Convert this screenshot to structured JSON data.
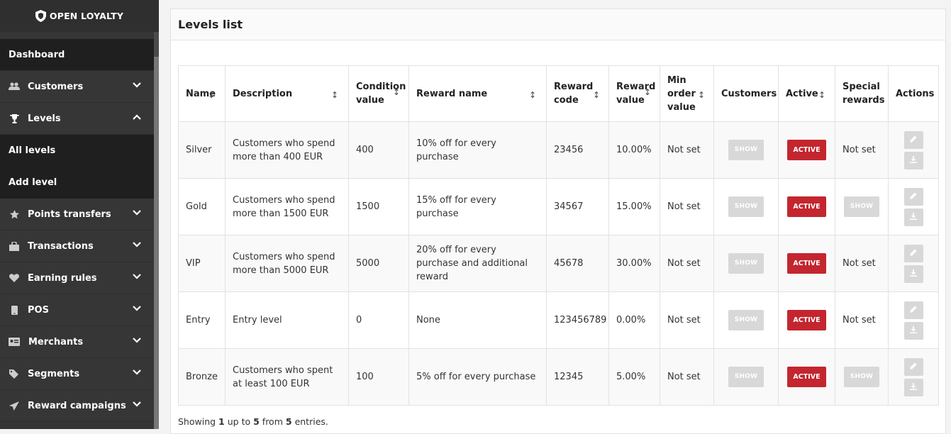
{
  "brand": {
    "name": "OPEN LOYALTY"
  },
  "sidebar": {
    "items": [
      {
        "label": "Dashboard",
        "icon": ""
      },
      {
        "label": "Customers",
        "icon": "users-icon"
      },
      {
        "label": "Levels",
        "icon": "trophy-icon"
      },
      {
        "label": "All levels"
      },
      {
        "label": "Add level"
      },
      {
        "label": "Points transfers",
        "icon": "star-icon"
      },
      {
        "label": "Transactions",
        "icon": "shopping-bag-icon"
      },
      {
        "label": "Earning rules",
        "icon": "heart-icon"
      },
      {
        "label": "POS",
        "icon": "mobile-icon"
      },
      {
        "label": "Merchants",
        "icon": "id-card-icon"
      },
      {
        "label": "Segments",
        "icon": "tags-icon"
      },
      {
        "label": "Reward campaigns",
        "icon": "paper-plane-icon"
      }
    ]
  },
  "page": {
    "title": "Levels list"
  },
  "table": {
    "headers": [
      "Name",
      "Description",
      "Condition value",
      "Reward name",
      "Reward code",
      "Reward value",
      "Min order value",
      "Customers",
      "Active",
      "Special rewards",
      "Actions"
    ],
    "show_label": "SHOW",
    "active_label": "ACTIVE",
    "rows": [
      {
        "name": "Silver",
        "description": "Customers who spend more than 400 EUR",
        "condition": "400",
        "reward_name": "10% off for every purchase",
        "reward_code": "23456",
        "reward_value": "10.00%",
        "min_order": "Not set",
        "special": "Not set"
      },
      {
        "name": "Gold",
        "description": "Customers who spend more than 1500 EUR",
        "condition": "1500",
        "reward_name": "15% off for every purchase",
        "reward_code": "34567",
        "reward_value": "15.00%",
        "min_order": "Not set",
        "special": "SHOW"
      },
      {
        "name": "VIP",
        "description": "Customers who spend more than 5000 EUR",
        "condition": "5000",
        "reward_name": "20% off for every purchase and additional reward",
        "reward_code": "45678",
        "reward_value": "30.00%",
        "min_order": "Not set",
        "special": "Not set"
      },
      {
        "name": "Entry",
        "description": "Entry level",
        "condition": "0",
        "reward_name": "None",
        "reward_code": "123456789",
        "reward_value": "0.00%",
        "min_order": "Not set",
        "special": "Not set"
      },
      {
        "name": "Bronze",
        "description": "Customers who spent at least 100 EUR",
        "condition": "100",
        "reward_name": "5% off for every purchase",
        "reward_code": "12345",
        "reward_value": "5.00%",
        "min_order": "Not set",
        "special": "SHOW"
      }
    ]
  },
  "footer": {
    "prefix": "Showing",
    "from": "1",
    "mid1": "up to",
    "to": "5",
    "mid2": "from",
    "total": "5",
    "suffix": "entries."
  }
}
